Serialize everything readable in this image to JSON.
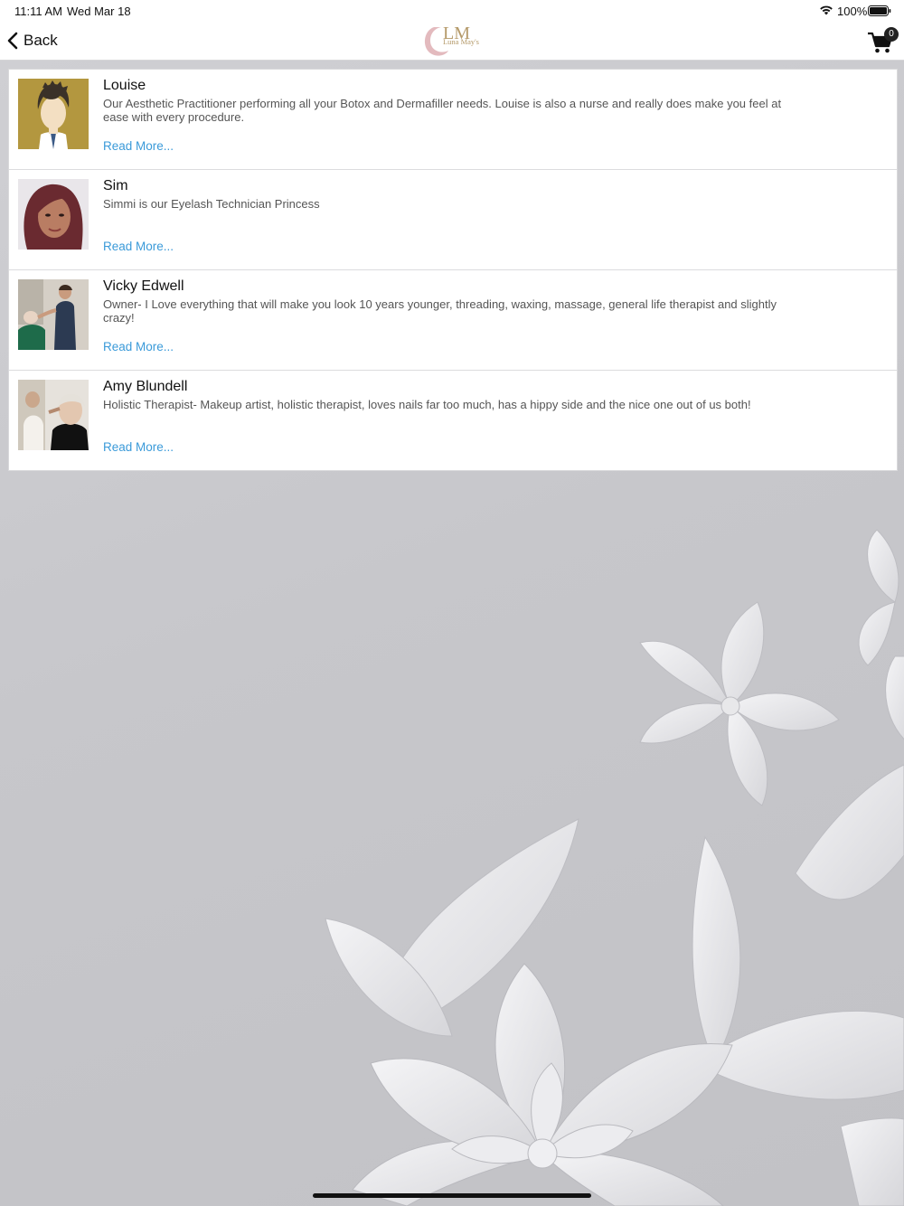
{
  "status_bar": {
    "time": "11:11 AM",
    "date": "Wed Mar 18",
    "battery_percent": "100%",
    "battery_level": 1.0
  },
  "nav": {
    "back_label": "Back",
    "logo_initials": "LM",
    "logo_text": "Luna May's",
    "cart_count": "0"
  },
  "staff": [
    {
      "name": "Louise",
      "description": "Our Aesthetic Practitioner performing all your Botox and Dermafiller needs. Louise is also a nurse and really does make you feel at ease with every procedure.",
      "read_more": "Read More..."
    },
    {
      "name": "Sim",
      "description": "Simmi is our Eyelash Technician Princess",
      "read_more": "Read More..."
    },
    {
      "name": "Vicky Edwell",
      "description": "Owner- I Love everything that will make you look 10 years younger, threading, waxing, massage, general life therapist and slightly crazy!",
      "read_more": "Read More..."
    },
    {
      "name": "Amy Blundell",
      "description": "Holistic Therapist- Makeup artist, holistic therapist, loves nails far too much, has a hippy side and the nice one out of us both!",
      "read_more": "Read More..."
    }
  ],
  "colors": {
    "link": "#3a9ad9",
    "logo_gold": "#b59a6a",
    "logo_rose": "#d9a3a8"
  }
}
